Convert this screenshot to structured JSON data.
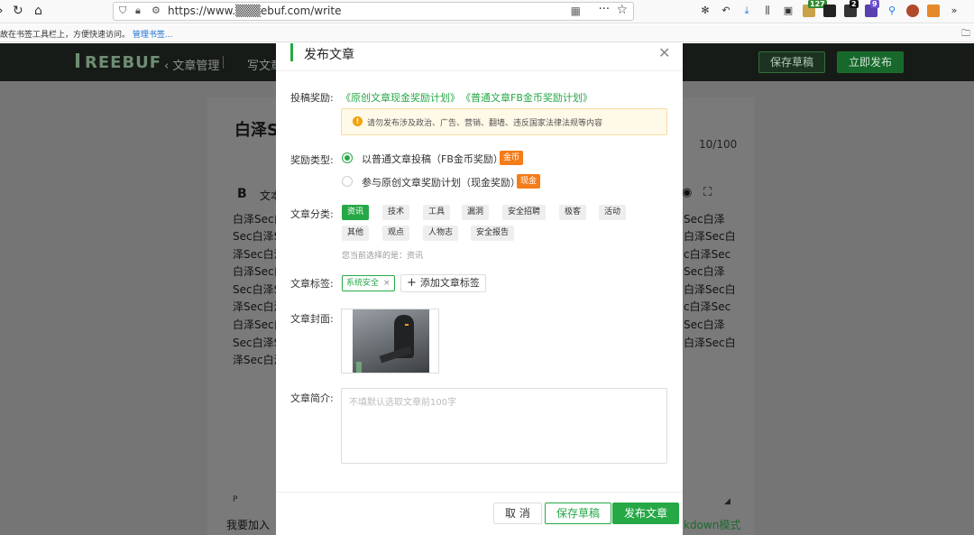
{
  "browser": {
    "url": "https://www.▒▒▒ebuf.com/write",
    "bookmark_prompt": "故在书签工具栏上，方便快速访问。",
    "bookmark_manage": "管理书签...",
    "ext_badges": [
      "127",
      "2",
      "9"
    ]
  },
  "header": {
    "logo": "REEBUF",
    "nav_manage": "文章管理",
    "nav_write": "写文章",
    "save_draft": "保存草稿",
    "publish_now": "立即发布"
  },
  "editor": {
    "title": "白泽S",
    "count": "10/100",
    "toolbar_bold": "B",
    "toolbar_text": "文本",
    "left_lines": [
      "白泽Sec白",
      "Sec白泽S",
      "泽Sec白泽",
      "白泽Sec白",
      "Sec白泽S",
      "泽Sec白泽",
      "白泽Sec白",
      "Sec白泽S",
      "泽Sec白泽"
    ],
    "right_lines": [
      "Sec白泽",
      "白泽Sec白",
      "c白泽Sec",
      "Sec白泽",
      "白泽Sec白",
      "c白泽Sec",
      "Sec白泽",
      "白泽Sec白",
      ""
    ],
    "p_marker": "P",
    "footer_left": "我要加入",
    "footer_right": "kdown模式"
  },
  "modal": {
    "title": "发布文章",
    "reward_label": "投稿奖励:",
    "reward_links": [
      "《原创文章现金奖励计划》",
      "《普通文章FB金币奖励计划》"
    ],
    "notice": "请勿发布涉及政治、广告、营销、翻墙、违反国家法律法规等内容",
    "reward_type_label": "奖励类型:",
    "reward_options": [
      {
        "label": "以普通文章投稿（FB金币奖励）",
        "badge": "金币",
        "selected": true
      },
      {
        "label": "参与原创文章奖励计划（现金奖励）",
        "badge": "现金",
        "selected": false
      }
    ],
    "category_label": "文章分类:",
    "categories_row1": [
      "资讯",
      "技术",
      "工具",
      "漏洞",
      "安全招聘",
      "极客",
      "活动"
    ],
    "categories_row2": [
      "其他",
      "观点",
      "人物志",
      "安全报告"
    ],
    "selected_category": "资讯",
    "category_hint": "您当前选择的是：资讯",
    "tags_label": "文章标签:",
    "tag_chip": "系统安全",
    "add_tag": "添加文章标签",
    "cover_label": "文章封面:",
    "summary_label": "文章简介:",
    "summary_placeholder": "不填默认选取文章前100字",
    "cancel": "取 消",
    "save_draft": "保存草稿",
    "publish": "发布文章"
  },
  "colors": {
    "accent": "#26a846",
    "badge_orange": "#f47c19",
    "notice_bg": "#fff9e8"
  }
}
